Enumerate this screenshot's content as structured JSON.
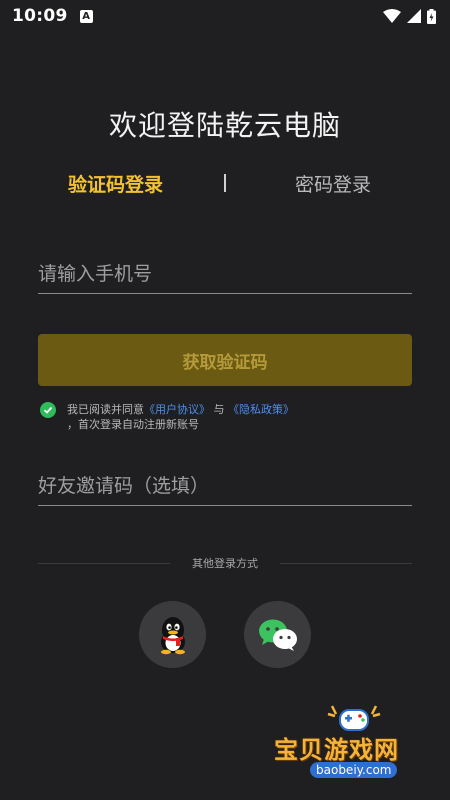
{
  "status_bar": {
    "time": "10:09",
    "notification_letter": "A"
  },
  "header": {
    "title": "欢迎登陆乾云电脑"
  },
  "tabs": [
    {
      "label": "验证码登录",
      "active": true
    },
    {
      "label": "密码登录",
      "active": false
    }
  ],
  "phone_input": {
    "placeholder": "请输入手机号",
    "value": ""
  },
  "get_code_button": {
    "label": "获取验证码"
  },
  "agreement": {
    "checked": true,
    "prefix": "我已阅读并同意",
    "user_agreement": "《用户协议》",
    "conjunction": "与",
    "privacy_policy": "《隐私政策》",
    "note": "，首次登录自动注册新账号"
  },
  "invite_input": {
    "placeholder": "好友邀请码（选填）",
    "value": ""
  },
  "other_login": {
    "label": "其他登录方式",
    "options": [
      "qq-icon",
      "wechat-icon"
    ]
  },
  "watermark": {
    "title": "宝贝游戏网",
    "url": "baobeiy.com"
  },
  "colors": {
    "background": "#1f1f21",
    "accent": "#f2c230",
    "button_disabled": "#6b5a12",
    "link": "#4d8ef0",
    "check": "#2fbb5a"
  }
}
